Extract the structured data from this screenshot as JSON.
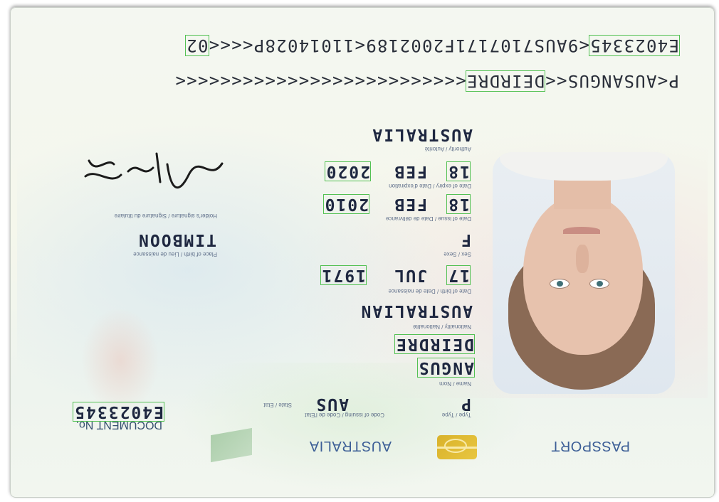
{
  "document": {
    "type_header": "PASSPORT",
    "country_header": "AUSTRALIA",
    "document_no_label": "DOCUMENT No.",
    "document_no": "E4023345",
    "fields": {
      "type_label": "Type / Type",
      "type_value": "P",
      "code_label": "Code of issuing / Code de l'Etat",
      "state_label": "State / Etat",
      "code_value": "AUS",
      "surname_label": "Name / Nom",
      "surname": "ANGUS",
      "given_names": "DEIRDRE",
      "nationality_label": "Nationality / Nationalité",
      "nationality": "AUSTRALIAN",
      "dob_label": "Date of birth / Date de naissance",
      "dob_day": "17",
      "dob_month": "JUL",
      "dob_year": "1971",
      "sex_label": "Sex / Sexe",
      "sex": "F",
      "pob_label": "Place of birth / Lieu de naissance",
      "pob": "TIMBOON",
      "doi_label": "Date of issue / Date de délivrance",
      "doi_day": "18",
      "doi_month": "FEB",
      "doi_year": "2010",
      "signature_label": "Holder's signature / Signature du titulaire",
      "doe_label": "Date of expiry / Date d'expiration",
      "doe_day": "18",
      "doe_month": "FEB",
      "doe_year": "2020",
      "authority_label": "Authority / Autorité",
      "authority": "AUSTRALIA"
    },
    "mrz": {
      "line1_prefix": "P<AUSANGUS<<",
      "line1_given": "DEIRDRE",
      "line1_fill": "<<<<<<<<<<<<<<<<<<<<<<<<<<",
      "line2_docno": "E4023345",
      "line2_middle": "<9AUS7107171F2002189<11014028P<<<<",
      "line2_end": "02"
    }
  },
  "colors": {
    "box_outline": "#53c153",
    "header_blue": "#3c5e96",
    "chip_gold": "#e0bd35"
  }
}
